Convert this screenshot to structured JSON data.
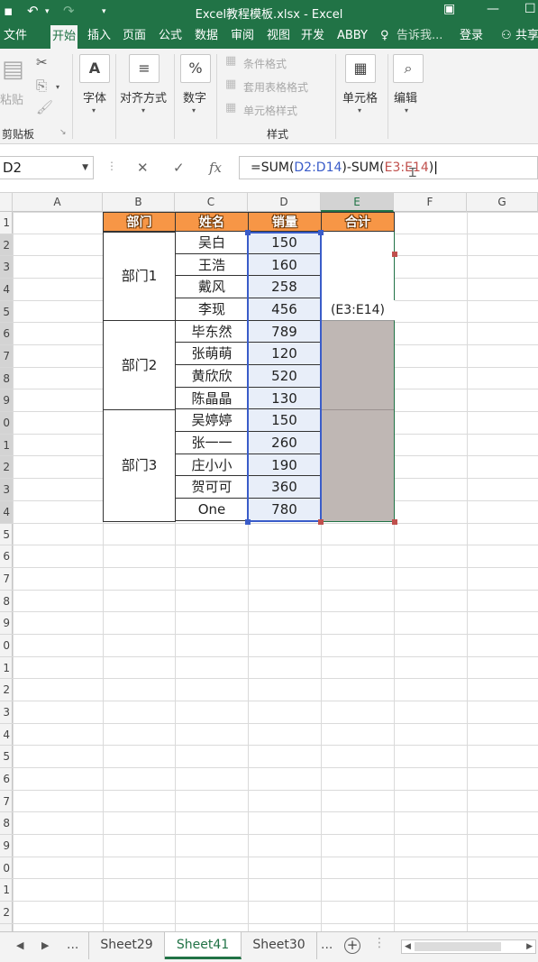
{
  "window": {
    "title": "Excel教程模板.xlsx - Excel"
  },
  "tabs": [
    "文件",
    "开始",
    "插入",
    "页面",
    "公式",
    "数据",
    "审阅",
    "视图",
    "开发",
    "ABBY"
  ],
  "tell_me": "告诉我...",
  "login": "登录",
  "share": "共享",
  "ribbon": {
    "paste": "粘贴",
    "clipboard": "剪贴板",
    "font": "字体",
    "align": "对齐方式",
    "number": "数字",
    "number_symbol": "%",
    "cond_format": "条件格式",
    "table_format": "套用表格格式",
    "cell_style": "单元格样式",
    "styles": "样式",
    "cells": "单元格",
    "edit": "编辑"
  },
  "formula_bar": {
    "name_box": "D2",
    "fx": "fx",
    "formula_prefix": "=SUM(",
    "ref1": "D2:D14",
    "formula_mid": ")-SUM(",
    "ref2": "E3:E14",
    "formula_suffix": ")"
  },
  "columns": [
    "A",
    "B",
    "C",
    "D",
    "E",
    "F",
    "G"
  ],
  "row_numbers": [
    "1",
    "2",
    "3",
    "4",
    "5",
    "6",
    "7",
    "8",
    "9",
    "0",
    "1",
    "2",
    "3",
    "4",
    "5",
    "6",
    "7",
    "8",
    "9",
    "0",
    "1",
    "2",
    "3",
    "4",
    "5",
    "6",
    "7",
    "8",
    "9",
    "0",
    "1",
    "2"
  ],
  "table": {
    "headers": [
      "部门",
      "姓名",
      "销量",
      "合计"
    ],
    "departments": [
      "部门1",
      "部门2",
      "部门3"
    ],
    "rows": [
      {
        "name": "吴白",
        "sales": "150"
      },
      {
        "name": "王浩",
        "sales": "160"
      },
      {
        "name": "戴风",
        "sales": "258"
      },
      {
        "name": "李现",
        "sales": "456"
      },
      {
        "name": "毕东然",
        "sales": "789"
      },
      {
        "name": "张萌萌",
        "sales": "120"
      },
      {
        "name": "黄欣欣",
        "sales": "520"
      },
      {
        "name": "陈晶晶",
        "sales": "130"
      },
      {
        "name": "吴婷婷",
        "sales": "150"
      },
      {
        "name": "张一一",
        "sales": "260"
      },
      {
        "name": "庄小小",
        "sales": "190"
      },
      {
        "name": "贺可可",
        "sales": "360"
      },
      {
        "name": "One",
        "sales": "780"
      }
    ],
    "edit_hint": "(E3:E14)"
  },
  "sheets": {
    "ellipsis": "...",
    "tabs": [
      "Sheet29",
      "Sheet41",
      "Sheet30"
    ],
    "active": "Sheet41",
    "add": "+"
  },
  "colors": {
    "excel_green": "#217346",
    "header_orange": "#f79646",
    "range_blue": "#3a5cc9",
    "ref_red": "#c0504d",
    "selection_gray": "#bfb7b4"
  }
}
